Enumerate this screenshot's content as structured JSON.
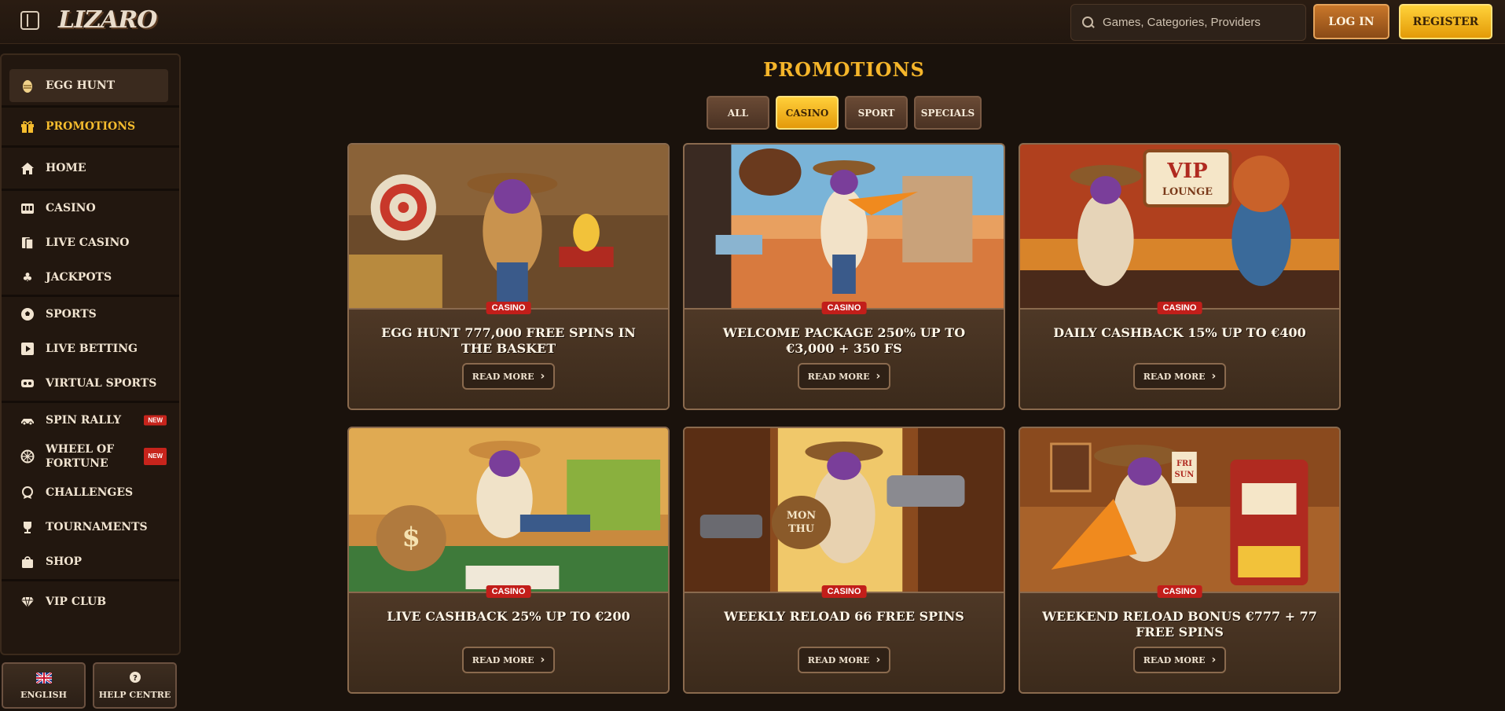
{
  "header": {
    "logo": "LIZARO",
    "search_placeholder": "Games, Categories, Providers",
    "login_label": "LOG IN",
    "register_label": "REGISTER"
  },
  "sidebar": {
    "egg_hunt": "EGG HUNT",
    "promotions": "PROMOTIONS",
    "home": "HOME",
    "casino": "CASINO",
    "live_casino": "LIVE CASINO",
    "jackpots": "JACKPOTS",
    "sports": "SPORTS",
    "live_betting": "LIVE BETTING",
    "virtual_sports": "VIRTUAL SPORTS",
    "spin_rally": "SPIN RALLY",
    "wheel_of_fortune_1": "WHEEL OF",
    "wheel_of_fortune_2": "FORTUNE",
    "challenges": "CHALLENGES",
    "tournaments": "TOURNAMENTS",
    "shop": "SHOP",
    "vip_club": "VIP CLUB",
    "new_badge": "NEW",
    "language_label": "ENGLISH",
    "help_label": "HELP CENTRE"
  },
  "main": {
    "title": "PROMOTIONS",
    "tabs": [
      "ALL",
      "CASINO",
      "SPORT",
      "SPECIALS"
    ],
    "active_tab": "CASINO",
    "read_more": "READ MORE",
    "cards": [
      {
        "badge": "CASINO",
        "title": "EGG HUNT 777,000 FREE SPINS IN THE BASKET"
      },
      {
        "badge": "CASINO",
        "title": "WELCOME PACKAGE 250% UP TO €3,000 + 350 FS"
      },
      {
        "badge": "CASINO",
        "title": "DAILY CASHBACK 15% UP TO €400"
      },
      {
        "badge": "CASINO",
        "title": "LIVE CASHBACK 25% UP TO €200"
      },
      {
        "badge": "CASINO",
        "title": "WEEKLY RELOAD 66 FREE SPINS"
      },
      {
        "badge": "CASINO",
        "title": "WEEKEND RELOAD BONUS €777 + 77 FREE SPINS"
      }
    ]
  },
  "colors": {
    "accent_gold": "#f5b52a",
    "badge_red": "#c21e1a",
    "background": "#1a120c"
  }
}
